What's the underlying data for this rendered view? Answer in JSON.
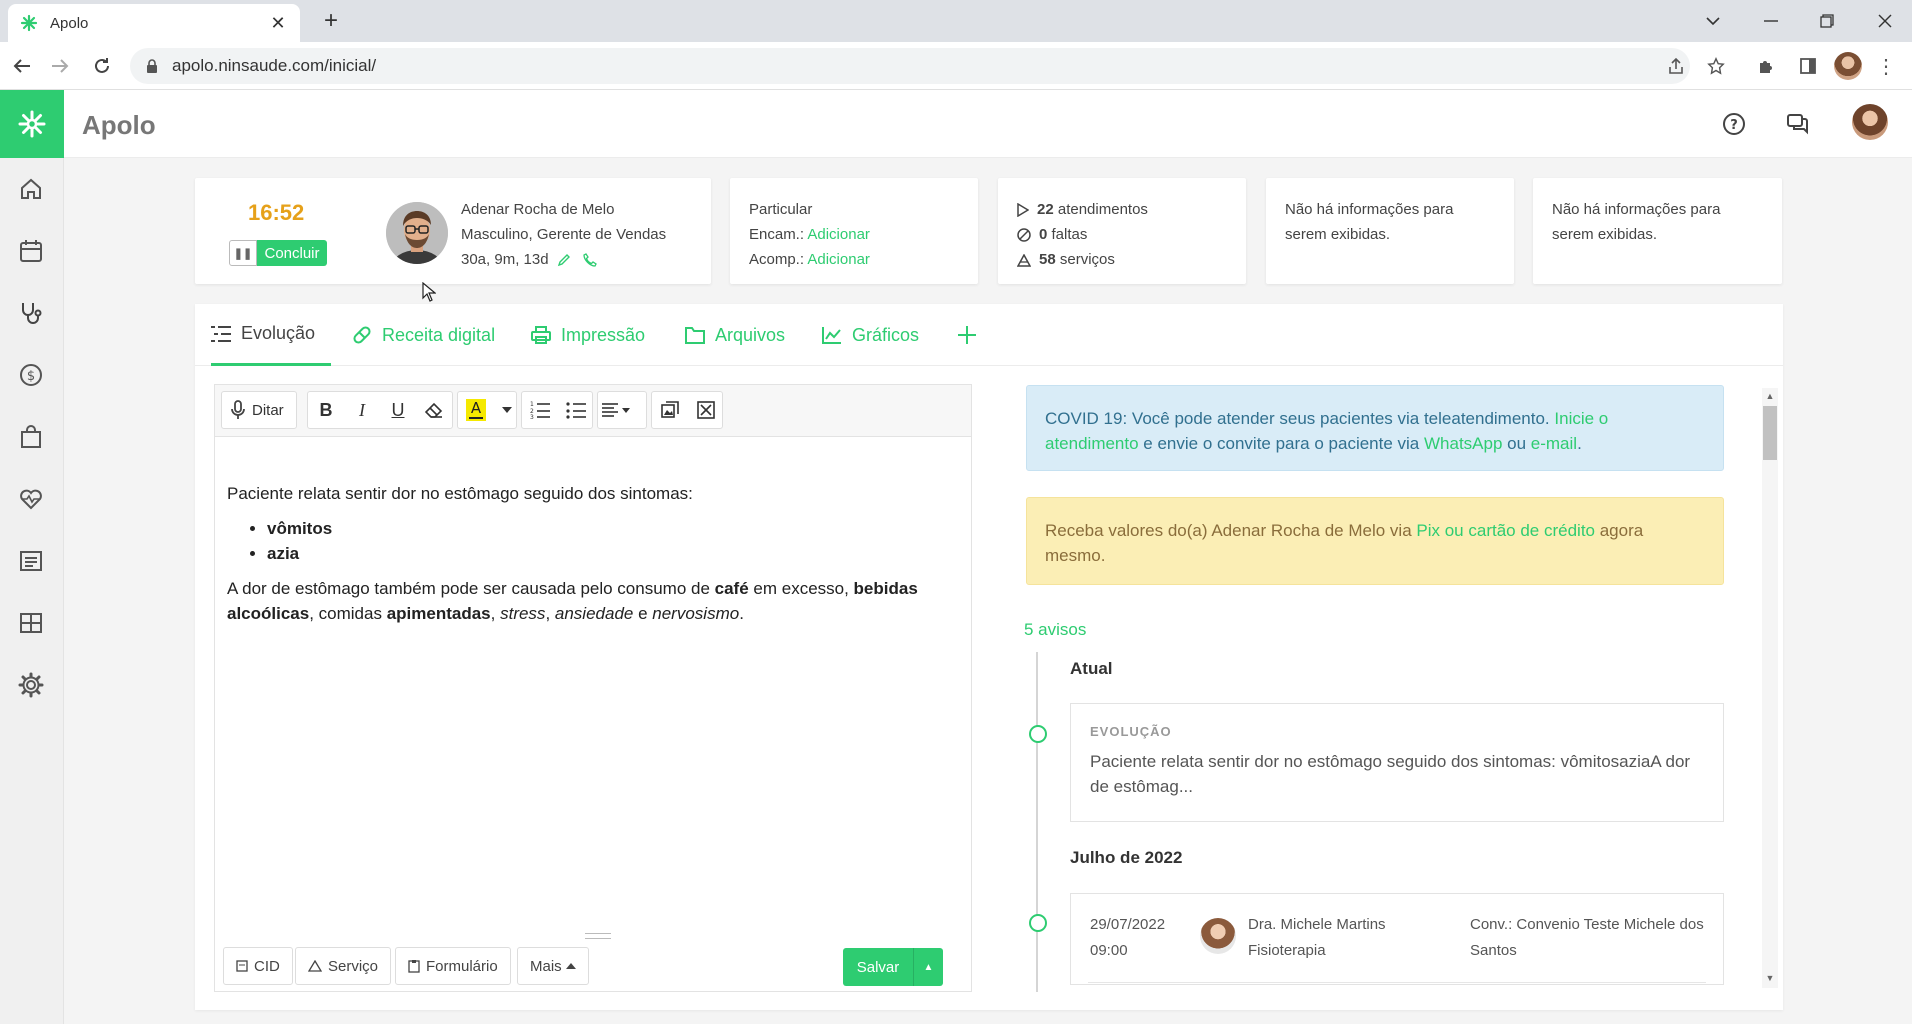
{
  "browser": {
    "tab_title": "Apolo",
    "url": "apolo.ninsaude.com/inicial/"
  },
  "app": {
    "brand": "Apolo",
    "accent_color": "#2ecc71",
    "sidebar_icons": [
      "home-icon",
      "calendar-icon",
      "stethoscope-icon",
      "dollar-icon",
      "bag-icon",
      "heartbeat-icon",
      "list-icon",
      "grid-icon",
      "gear-icon"
    ],
    "topbar_icons": [
      "help-icon",
      "chat-icon",
      "user-avatar"
    ]
  },
  "header": {
    "timer": "16:52",
    "conclude_label": "Concluir",
    "patient": {
      "name": "Adenar Rocha de Melo",
      "details": "Masculino, Gerente de Vendas",
      "age": "30a, 9m, 13d"
    },
    "insurance": {
      "plan": "Particular",
      "encam_label": "Encam.:",
      "encam_link": "Adicionar",
      "acomp_label": "Acomp.:",
      "acomp_link": "Adicionar"
    },
    "stats": {
      "attendances_count": "22",
      "attendances_label": "atendimentos",
      "absences_count": "0",
      "absences_label": "faltas",
      "services_count": "58",
      "services_label": "serviços"
    },
    "info1_line1": "Não há informações para",
    "info1_line2": "serem exibidas.",
    "info2_line1": "Não há informações para",
    "info2_line2": "serem exibidas."
  },
  "tabs": {
    "evolucao": "Evolução",
    "receita": "Receita digital",
    "impressao": "Impressão",
    "arquivos": "Arquivos",
    "graficos": "Gráficos"
  },
  "editor": {
    "dictate_label": "Ditar",
    "content": {
      "intro": "Paciente relata sentir dor no estômago seguido dos sintomas:",
      "symptoms": [
        "vômitos",
        "azia"
      ],
      "p2_a": "A dor de estômago também pode ser causada pelo consumo de ",
      "p2_cafe": "café",
      "p2_b": " em excesso, ",
      "p2_bebidas": "bebidas alcoólicas",
      "p2_c": ", comidas ",
      "p2_apimentadas": "apimentadas",
      "p2_d": ", ",
      "p2_stress": "stress",
      "p2_e": ", ",
      "p2_ansiedade": "ansiedade",
      "p2_f": " e ",
      "p2_nervosismo": "nervosismo",
      "p2_g": "."
    },
    "footer": {
      "cid": "CID",
      "servico": "Serviço",
      "formulario": "Formulário",
      "mais": "Mais",
      "salvar": "Salvar"
    }
  },
  "alerts": {
    "covid_a": "COVID 19: Você pode atender seus pacientes via teleatendimento. ",
    "covid_link1": "Inicie o atendimento",
    "covid_b": " e envie o convite para o paciente via ",
    "covid_link2": "WhatsApp",
    "covid_c": " ou ",
    "covid_link3": "e-mail",
    "covid_d": ".",
    "pix_a": "Receba valores do(a) Adenar Rocha de Melo via ",
    "pix_link": "Pix ou cartão de crédito",
    "pix_b": " agora mesmo."
  },
  "timeline": {
    "avisos": "5 avisos",
    "current_heading": "Atual",
    "evolution_label": "EVOLUÇÃO",
    "evolution_text": "Paciente relata sentir dor no estômago seguido dos sintomas: vômitosaziaA dor de estômag...",
    "month_heading": "Julho de 2022",
    "appointment": {
      "date": "29/07/2022",
      "time": "09:00",
      "doctor": "Dra. Michele Martins",
      "specialty": "Fisioterapia",
      "insurance": "Conv.: Convenio Teste Michele dos Santos"
    }
  }
}
